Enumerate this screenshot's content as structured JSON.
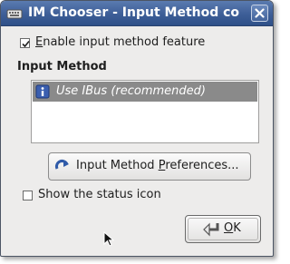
{
  "window": {
    "title": "IM Chooser - Input Method co",
    "app_icon": "keyboard-icon",
    "close_icon": "close-icon"
  },
  "enable_checkbox": {
    "label_prefix": "",
    "label_mnemonic": "E",
    "label_rest": "nable input method feature",
    "checked": true
  },
  "input_method": {
    "section_title": "Input Method",
    "items": [
      {
        "label": "Use IBus (recommended)",
        "icon": "info-icon",
        "selected": true
      }
    ]
  },
  "preferences_button": {
    "label_prefix": "Input Method ",
    "label_mnemonic": "P",
    "label_rest": "references...",
    "icon": "refresh-arrow-icon"
  },
  "status_checkbox": {
    "label": "Show the status icon",
    "checked": false
  },
  "ok_button": {
    "label_mnemonic": "O",
    "label_rest": "K",
    "icon": "ok-arrow-icon"
  },
  "colors": {
    "titlebar": "#3d5e97",
    "selection": "#8a8a8a",
    "background": "#edeceb"
  }
}
